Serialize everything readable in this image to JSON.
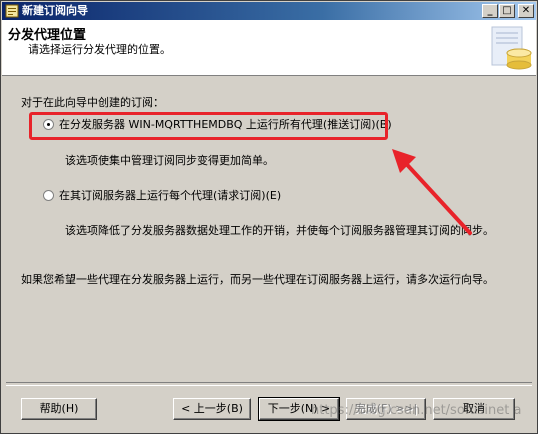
{
  "window": {
    "title": "新建订阅向导",
    "minimize_glyph": "_",
    "maximize_glyph": "□",
    "close_glyph": "✕"
  },
  "header": {
    "title": "分发代理位置",
    "subtitle": "请选择运行分发代理的位置。",
    "graphic_icon": "database-cylinder-icon"
  },
  "main": {
    "section_label": "对于在此向导中创建的订阅：",
    "options": [
      {
        "label": "在分发服务器 WIN-MQRTTHEMDBQ 上运行所有代理(推送订阅)(B)",
        "selected": true,
        "description": "该选项使集中管理订阅同步变得更加简单。"
      },
      {
        "label": "在其订阅服务器上运行每个代理(请求订阅)(E)",
        "selected": false,
        "description": "该选项降低了分发服务器数据处理工作的开销，并使每个订阅服务器管理其订阅的同步。"
      }
    ],
    "note": "如果您希望一些代理在分发服务器上运行，而另一些代理在订阅服务器上运行，请多次运行向导。"
  },
  "annotation": {
    "highlight_color": "#e8232a",
    "arrow_color": "#e8232a"
  },
  "buttons": {
    "help": "帮助(H)",
    "back": "< 上一步(B)",
    "next": "下一步(N) >",
    "finish": "完成(F) >>|",
    "cancel": "取消"
  },
  "watermark": "https://blog.csdn.net/sofusinet a"
}
